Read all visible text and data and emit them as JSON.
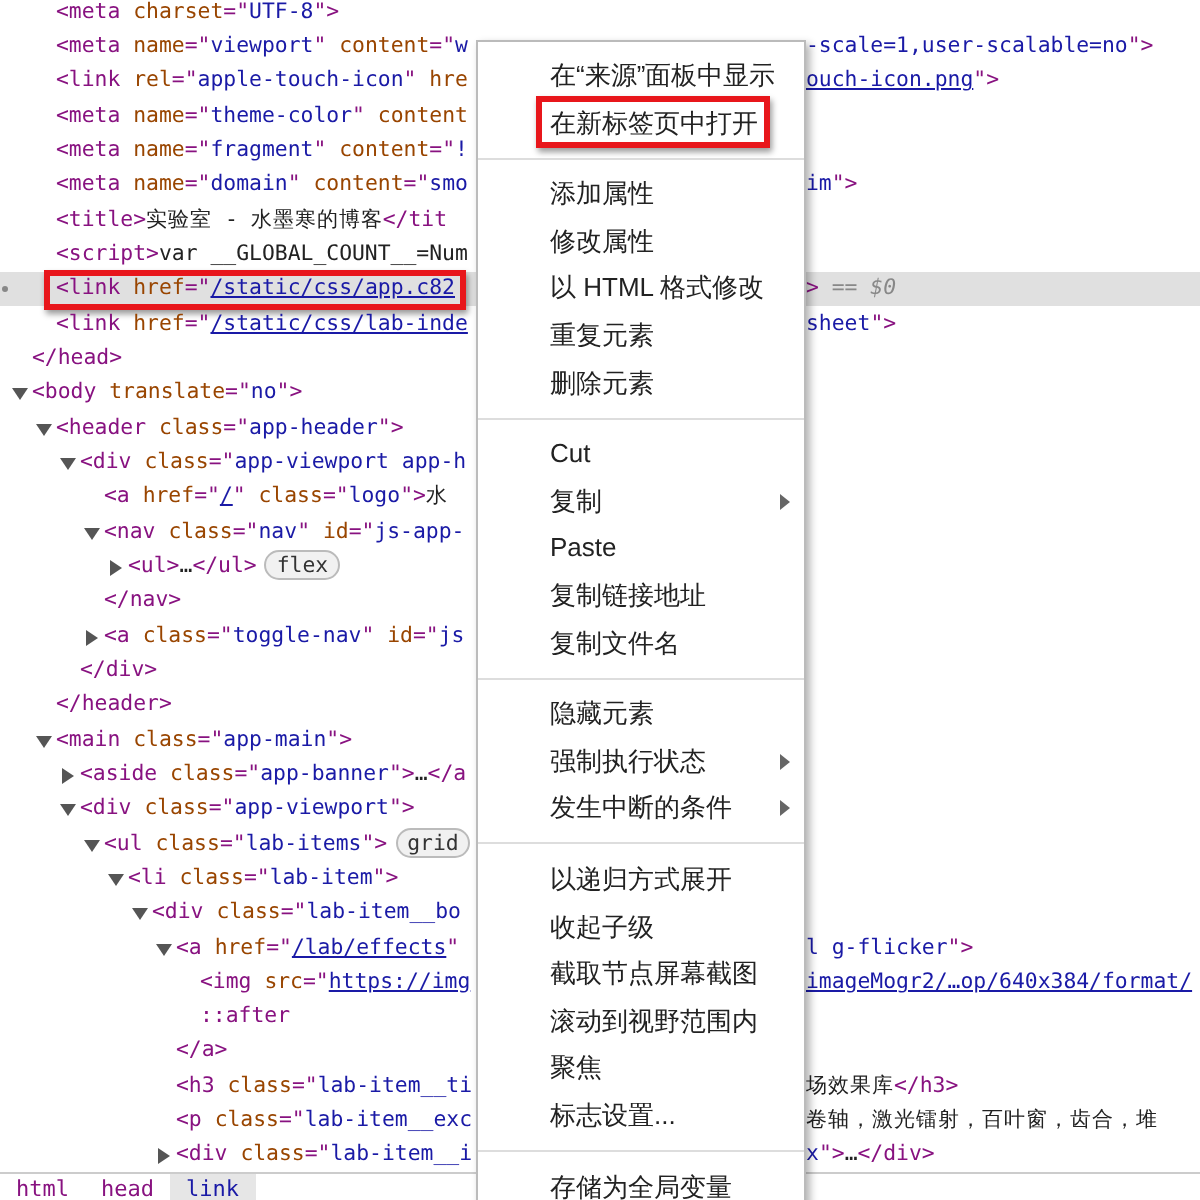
{
  "tree": [
    {
      "children": [
        {
          "selected": false,
          "annotated": false,
          "open": [
            {
              "kind": "tag",
              "text": "<meta "
            },
            {
              "kind": "attr",
              "text": "charset"
            },
            {
              "kind": "tag",
              "text": "=\""
            },
            {
              "kind": "value",
              "text": "UTF-8"
            },
            {
              "kind": "tag",
              "text": "\">"
            }
          ]
        },
        {
          "selected": false,
          "annotated": false,
          "open": [
            {
              "kind": "tag",
              "text": "<meta "
            },
            {
              "kind": "attr",
              "text": "name"
            },
            {
              "kind": "tag",
              "text": "=\""
            },
            {
              "kind": "value",
              "text": "viewport"
            },
            {
              "kind": "tag",
              "text": "\" "
            },
            {
              "kind": "attr",
              "text": "content"
            },
            {
              "kind": "tag",
              "text": "=\""
            },
            {
              "kind": "value",
              "text": "w"
            }
          ],
          "right": [
            {
              "kind": "value",
              "text": "-scale=1,user-scalable=no"
            },
            {
              "kind": "tag",
              "text": "\">"
            }
          ]
        },
        {
          "selected": false,
          "annotated": false,
          "open": [
            {
              "kind": "tag",
              "text": "<link "
            },
            {
              "kind": "attr",
              "text": "rel"
            },
            {
              "kind": "tag",
              "text": "=\""
            },
            {
              "kind": "value",
              "text": "apple-touch-icon"
            },
            {
              "kind": "tag",
              "text": "\" "
            },
            {
              "kind": "attr",
              "text": "hre"
            }
          ],
          "right": [
            {
              "kind": "link",
              "text": "ouch-icon.png"
            },
            {
              "kind": "tag",
              "text": "\">"
            }
          ]
        },
        {
          "selected": false,
          "annotated": false,
          "open": [
            {
              "kind": "tag",
              "text": "<meta "
            },
            {
              "kind": "attr",
              "text": "name"
            },
            {
              "kind": "tag",
              "text": "=\""
            },
            {
              "kind": "value",
              "text": "theme-color"
            },
            {
              "kind": "tag",
              "text": "\" "
            },
            {
              "kind": "attr",
              "text": "content"
            }
          ]
        },
        {
          "selected": false,
          "annotated": false,
          "open": [
            {
              "kind": "tag",
              "text": "<meta "
            },
            {
              "kind": "attr",
              "text": "name"
            },
            {
              "kind": "tag",
              "text": "=\""
            },
            {
              "kind": "value",
              "text": "fragment"
            },
            {
              "kind": "tag",
              "text": "\" "
            },
            {
              "kind": "attr",
              "text": "content"
            },
            {
              "kind": "tag",
              "text": "=\""
            },
            {
              "kind": "value",
              "text": "!"
            }
          ]
        },
        {
          "selected": false,
          "annotated": false,
          "open": [
            {
              "kind": "tag",
              "text": "<meta "
            },
            {
              "kind": "attr",
              "text": "name"
            },
            {
              "kind": "tag",
              "text": "=\""
            },
            {
              "kind": "value",
              "text": "domain"
            },
            {
              "kind": "tag",
              "text": "\" "
            },
            {
              "kind": "attr",
              "text": "content"
            },
            {
              "kind": "tag",
              "text": "=\""
            },
            {
              "kind": "value",
              "text": "smo"
            }
          ],
          "right": [
            {
              "kind": "value",
              "text": "im"
            },
            {
              "kind": "tag",
              "text": "\">"
            }
          ]
        },
        {
          "selected": false,
          "annotated": false,
          "open": [
            {
              "kind": "tag",
              "text": "<title>"
            },
            {
              "kind": "text",
              "text": "实验室 - 水墨寒的博客"
            },
            {
              "kind": "tag",
              "text": "</tit"
            }
          ]
        },
        {
          "selected": false,
          "annotated": false,
          "open": [
            {
              "kind": "tag",
              "text": "<script>"
            },
            {
              "kind": "text",
              "text": "var __GLOBAL_COUNT__=Num"
            }
          ]
        },
        {
          "selected": true,
          "annotated": true,
          "open": [
            {
              "kind": "tag",
              "text": "<link "
            },
            {
              "kind": "attr",
              "text": "href"
            },
            {
              "kind": "tag",
              "text": "=\""
            },
            {
              "kind": "link",
              "text": "/static/css/app.c82"
            }
          ],
          "right": [
            {
              "kind": "tag",
              "text": ">"
            },
            {
              "kind": "marker",
              "text": " == $0"
            }
          ]
        },
        {
          "selected": false,
          "annotated": false,
          "open": [
            {
              "kind": "tag",
              "text": "<link "
            },
            {
              "kind": "attr",
              "text": "href"
            },
            {
              "kind": "tag",
              "text": "=\""
            },
            {
              "kind": "link",
              "text": "/static/css/lab-inde"
            }
          ],
          "right": [
            {
              "kind": "value",
              "text": "sheet"
            },
            {
              "kind": "tag",
              "text": "\">"
            }
          ]
        }
      ],
      "close": [
        {
          "kind": "tag",
          "text": "</head>"
        }
      ]
    },
    {
      "selected": false,
      "annotated": false,
      "expanded": true,
      "open": [
        {
          "kind": "tag",
          "text": "<body "
        },
        {
          "kind": "attr",
          "text": "translate"
        },
        {
          "kind": "tag",
          "text": "=\""
        },
        {
          "kind": "value",
          "text": "no"
        },
        {
          "kind": "tag",
          "text": "\">"
        }
      ],
      "children": [
        {
          "selected": false,
          "annotated": false,
          "expanded": true,
          "open": [
            {
              "kind": "tag",
              "text": "<header "
            },
            {
              "kind": "attr",
              "text": "class"
            },
            {
              "kind": "tag",
              "text": "=\""
            },
            {
              "kind": "value",
              "text": "app-header"
            },
            {
              "kind": "tag",
              "text": "\">"
            }
          ],
          "close": [
            {
              "kind": "tag",
              "text": "</header>"
            }
          ],
          "children": [
            {
              "selected": false,
              "annotated": false,
              "expanded": true,
              "open": [
                {
                  "kind": "tag",
                  "text": "<div "
                },
                {
                  "kind": "attr",
                  "text": "class"
                },
                {
                  "kind": "tag",
                  "text": "=\""
                },
                {
                  "kind": "value",
                  "text": "app-viewport app-h"
                }
              ],
              "close": [
                {
                  "kind": "tag",
                  "text": "</div>"
                }
              ],
              "children": [
                {
                  "selected": false,
                  "annotated": false,
                  "open": [
                    {
                      "kind": "tag",
                      "text": "<a "
                    },
                    {
                      "kind": "attr",
                      "text": "href"
                    },
                    {
                      "kind": "tag",
                      "text": "=\""
                    },
                    {
                      "kind": "link",
                      "text": "/"
                    },
                    {
                      "kind": "tag",
                      "text": "\" "
                    },
                    {
                      "kind": "attr",
                      "text": "class"
                    },
                    {
                      "kind": "tag",
                      "text": "=\""
                    },
                    {
                      "kind": "value",
                      "text": "logo"
                    },
                    {
                      "kind": "tag",
                      "text": "\">"
                    },
                    {
                      "kind": "text",
                      "text": "水"
                    }
                  ]
                },
                {
                  "selected": false,
                  "annotated": false,
                  "expanded": true,
                  "open": [
                    {
                      "kind": "tag",
                      "text": "<nav "
                    },
                    {
                      "kind": "attr",
                      "text": "class"
                    },
                    {
                      "kind": "tag",
                      "text": "=\""
                    },
                    {
                      "kind": "value",
                      "text": "nav"
                    },
                    {
                      "kind": "tag",
                      "text": "\" "
                    },
                    {
                      "kind": "attr",
                      "text": "id"
                    },
                    {
                      "kind": "tag",
                      "text": "=\""
                    },
                    {
                      "kind": "value",
                      "text": "js-app-"
                    }
                  ],
                  "close": [
                    {
                      "kind": "tag",
                      "text": "</nav>"
                    }
                  ],
                  "children": [
                    {
                      "selected": false,
                      "annotated": false,
                      "expanded": false,
                      "open": [
                        {
                          "kind": "tag",
                          "text": "<ul>"
                        },
                        {
                          "kind": "text",
                          "text": "…"
                        },
                        {
                          "kind": "tag",
                          "text": "</ul>"
                        },
                        {
                          "kind": "badge",
                          "text": "flex"
                        }
                      ]
                    }
                  ]
                },
                {
                  "selected": false,
                  "annotated": false,
                  "expanded": false,
                  "open": [
                    {
                      "kind": "tag",
                      "text": "<a "
                    },
                    {
                      "kind": "attr",
                      "text": "class"
                    },
                    {
                      "kind": "tag",
                      "text": "=\""
                    },
                    {
                      "kind": "value",
                      "text": "toggle-nav"
                    },
                    {
                      "kind": "tag",
                      "text": "\" "
                    },
                    {
                      "kind": "attr",
                      "text": "id"
                    },
                    {
                      "kind": "tag",
                      "text": "=\""
                    },
                    {
                      "kind": "value",
                      "text": "js"
                    }
                  ]
                }
              ]
            }
          ]
        },
        {
          "selected": false,
          "annotated": false,
          "expanded": true,
          "open": [
            {
              "kind": "tag",
              "text": "<main "
            },
            {
              "kind": "attr",
              "text": "class"
            },
            {
              "kind": "tag",
              "text": "=\""
            },
            {
              "kind": "value",
              "text": "app-main"
            },
            {
              "kind": "tag",
              "text": "\">"
            }
          ],
          "children": [
            {
              "selected": false,
              "annotated": false,
              "expanded": false,
              "open": [
                {
                  "kind": "tag",
                  "text": "<aside "
                },
                {
                  "kind": "attr",
                  "text": "class"
                },
                {
                  "kind": "tag",
                  "text": "=\""
                },
                {
                  "kind": "value",
                  "text": "app-banner"
                },
                {
                  "kind": "tag",
                  "text": "\">"
                },
                {
                  "kind": "text",
                  "text": "…"
                },
                {
                  "kind": "tag",
                  "text": "</a"
                }
              ]
            },
            {
              "selected": false,
              "annotated": false,
              "expanded": true,
              "open": [
                {
                  "kind": "tag",
                  "text": "<div "
                },
                {
                  "kind": "attr",
                  "text": "class"
                },
                {
                  "kind": "tag",
                  "text": "=\""
                },
                {
                  "kind": "value",
                  "text": "app-viewport"
                },
                {
                  "kind": "tag",
                  "text": "\">"
                }
              ],
              "children": [
                {
                  "selected": false,
                  "annotated": false,
                  "expanded": true,
                  "open": [
                    {
                      "kind": "tag",
                      "text": "<ul "
                    },
                    {
                      "kind": "attr",
                      "text": "class"
                    },
                    {
                      "kind": "tag",
                      "text": "=\""
                    },
                    {
                      "kind": "value",
                      "text": "lab-items"
                    },
                    {
                      "kind": "tag",
                      "text": "\">"
                    },
                    {
                      "kind": "badge",
                      "text": "grid"
                    }
                  ],
                  "children": [
                    {
                      "selected": false,
                      "annotated": false,
                      "expanded": true,
                      "open": [
                        {
                          "kind": "tag",
                          "text": "<li "
                        },
                        {
                          "kind": "attr",
                          "text": "class"
                        },
                        {
                          "kind": "tag",
                          "text": "=\""
                        },
                        {
                          "kind": "value",
                          "text": "lab-item"
                        },
                        {
                          "kind": "tag",
                          "text": "\">"
                        }
                      ],
                      "children": [
                        {
                          "selected": false,
                          "annotated": false,
                          "expanded": true,
                          "open": [
                            {
                              "kind": "tag",
                              "text": "<div "
                            },
                            {
                              "kind": "attr",
                              "text": "class"
                            },
                            {
                              "kind": "tag",
                              "text": "=\""
                            },
                            {
                              "kind": "value",
                              "text": "lab-item__bo"
                            }
                          ],
                          "children": [
                            {
                              "selected": false,
                              "annotated": false,
                              "expanded": true,
                              "open": [
                                {
                                  "kind": "tag",
                                  "text": "<a "
                                },
                                {
                                  "kind": "attr",
                                  "text": "href"
                                },
                                {
                                  "kind": "tag",
                                  "text": "=\""
                                },
                                {
                                  "kind": "link",
                                  "text": "/lab/effects"
                                },
                                {
                                  "kind": "tag",
                                  "text": "\""
                                }
                              ],
                              "right": [
                                {
                                  "kind": "value",
                                  "text": "l g-flicker"
                                },
                                {
                                  "kind": "tag",
                                  "text": "\">"
                                }
                              ],
                              "close": [
                                {
                                  "kind": "tag",
                                  "text": "</a>"
                                }
                              ],
                              "children": [
                                {
                                  "selected": false,
                                  "annotated": false,
                                  "open": [
                                    {
                                      "kind": "tag",
                                      "text": "<img "
                                    },
                                    {
                                      "kind": "attr",
                                      "text": "src"
                                    },
                                    {
                                      "kind": "tag",
                                      "text": "=\""
                                    },
                                    {
                                      "kind": "link",
                                      "text": "https://img"
                                    }
                                  ],
                                  "right": [
                                    {
                                      "kind": "link",
                                      "text": "imageMogr2/…op/640x384/format/"
                                    }
                                  ]
                                },
                                {
                                  "selected": false,
                                  "annotated": false,
                                  "open": [
                                    {
                                      "kind": "pseudo",
                                      "text": "::after"
                                    }
                                  ]
                                }
                              ]
                            },
                            {
                              "selected": false,
                              "annotated": false,
                              "open": [
                                {
                                  "kind": "tag",
                                  "text": "<h3 "
                                },
                                {
                                  "kind": "attr",
                                  "text": "class"
                                },
                                {
                                  "kind": "tag",
                                  "text": "=\""
                                },
                                {
                                  "kind": "value",
                                  "text": "lab-item__ti"
                                }
                              ],
                              "right": [
                                {
                                  "kind": "text",
                                  "text": "场效果库"
                                },
                                {
                                  "kind": "tag",
                                  "text": "</h3>"
                                }
                              ]
                            },
                            {
                              "selected": false,
                              "annotated": false,
                              "open": [
                                {
                                  "kind": "tag",
                                  "text": "<p "
                                },
                                {
                                  "kind": "attr",
                                  "text": "class"
                                },
                                {
                                  "kind": "tag",
                                  "text": "=\""
                                },
                                {
                                  "kind": "value",
                                  "text": "lab-item__exc"
                                }
                              ],
                              "right": [
                                {
                                  "kind": "text",
                                  "text": "卷轴，激光镭射，百叶窗，齿合，堆"
                                }
                              ]
                            },
                            {
                              "selected": false,
                              "annotated": false,
                              "expanded": false,
                              "open": [
                                {
                                  "kind": "tag",
                                  "text": "<div "
                                },
                                {
                                  "kind": "attr",
                                  "text": "class"
                                },
                                {
                                  "kind": "tag",
                                  "text": "=\""
                                },
                                {
                                  "kind": "value",
                                  "text": "lab-item__i"
                                }
                              ],
                              "right": [
                                {
                                  "kind": "value",
                                  "text": "x"
                                },
                                {
                                  "kind": "tag",
                                  "text": "\">"
                                },
                                {
                                  "kind": "text",
                                  "text": "…"
                                },
                                {
                                  "kind": "tag",
                                  "text": "</div>"
                                }
                              ]
                            }
                          ]
                        }
                      ]
                    }
                  ]
                }
              ]
            }
          ]
        }
      ]
    }
  ],
  "breadcrumbs": [
    {
      "label": "html",
      "selected": false
    },
    {
      "label": "head",
      "selected": false
    },
    {
      "label": "link",
      "selected": true
    }
  ],
  "menu": [
    {
      "kind": "item",
      "label": "在“来源”面板中显示",
      "submenu": false,
      "annotated": false
    },
    {
      "kind": "item",
      "label": "在新标签页中打开",
      "submenu": false,
      "annotated": true
    },
    {
      "kind": "separator"
    },
    {
      "kind": "item",
      "label": "添加属性",
      "submenu": false,
      "annotated": false
    },
    {
      "kind": "item",
      "label": "修改属性",
      "submenu": false,
      "annotated": false
    },
    {
      "kind": "item",
      "label": "以 HTML 格式修改",
      "submenu": false,
      "annotated": false
    },
    {
      "kind": "item",
      "label": "重复元素",
      "submenu": false,
      "annotated": false
    },
    {
      "kind": "item",
      "label": "删除元素",
      "submenu": false,
      "annotated": false
    },
    {
      "kind": "separator"
    },
    {
      "kind": "item",
      "label": "Cut",
      "submenu": false,
      "annotated": false
    },
    {
      "kind": "item",
      "label": "复制",
      "submenu": true,
      "annotated": false
    },
    {
      "kind": "item",
      "label": "Paste",
      "submenu": false,
      "annotated": false
    },
    {
      "kind": "item",
      "label": "复制链接地址",
      "submenu": false,
      "annotated": false
    },
    {
      "kind": "item",
      "label": "复制文件名",
      "submenu": false,
      "annotated": false
    },
    {
      "kind": "separator"
    },
    {
      "kind": "item",
      "label": "隐藏元素",
      "submenu": false,
      "annotated": false
    },
    {
      "kind": "item",
      "label": "强制执行状态",
      "submenu": true,
      "annotated": false
    },
    {
      "kind": "item",
      "label": "发生中断的条件",
      "submenu": true,
      "annotated": false
    },
    {
      "kind": "separator"
    },
    {
      "kind": "item",
      "label": "以递归方式展开",
      "submenu": false,
      "annotated": false
    },
    {
      "kind": "item",
      "label": "收起子级",
      "submenu": false,
      "annotated": false
    },
    {
      "kind": "item",
      "label": "截取节点屏幕截图",
      "submenu": false,
      "annotated": false
    },
    {
      "kind": "item",
      "label": "滚动到视野范围内",
      "submenu": false,
      "annotated": false
    },
    {
      "kind": "item",
      "label": "聚焦",
      "submenu": false,
      "annotated": false
    },
    {
      "kind": "item",
      "label": "标志设置...",
      "submenu": false,
      "annotated": false
    },
    {
      "kind": "separator"
    },
    {
      "kind": "item",
      "label": "存储为全局变量",
      "submenu": false,
      "annotated": false
    }
  ]
}
